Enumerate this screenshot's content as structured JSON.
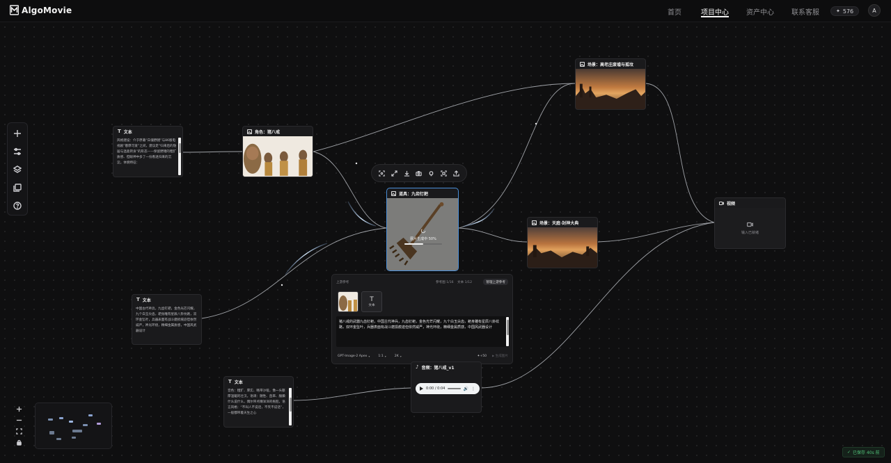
{
  "app": {
    "name": "AlgoMovie"
  },
  "nav": {
    "items": [
      {
        "label": "首页",
        "active": false
      },
      {
        "label": "项目中心",
        "active": true
      },
      {
        "label": "资产中心",
        "active": false
      },
      {
        "label": "联系客服",
        "active": false
      }
    ]
  },
  "credits": {
    "value": "576"
  },
  "user": {
    "initial": "A"
  },
  "toolbar": {
    "tools": [
      "plus-icon",
      "sliders-icon",
      "layers-icon",
      "gallery-icon",
      "help-icon"
    ]
  },
  "nodes": {
    "text1": {
      "title": "文本",
      "content": "风格建设：介于原著“白僵野猪”与86版电视剧“憨厚可爱”之间，建议走“归来后的隐居与温柔转身”的形态——保留野猪的粗犷质感、但眼神中多了一份看透归来的沉淀。体貌特征："
    },
    "character": {
      "title": "角色：猪八戒"
    },
    "prop": {
      "title": "道具：九齿钉耙",
      "progress_label": "图片生成中 50%",
      "progress": 0.5
    },
    "scene1": {
      "title": "场景：高老庄废墟与孤坟"
    },
    "scene2": {
      "title": "场景：天庭·封神大典"
    },
    "video": {
      "title": "视频",
      "placeholder": "输入已就绪"
    },
    "text2": {
      "title": "文本",
      "content": "中国古代神兵，九齿钉耙，金色光芒闪耀，九个白玉尖齿，耙身雕有星辰八卦纹路，双环金坠叶，兵器表面有战斗磨损痕迹但依然威严，神光环绕，精细金属质感，中国风武器设计"
    },
    "text3": {
      "title": "文本",
      "content": "音色：粗犷、厚实、略带沙哑，像一头憨厚温暖的壮汉。语调：随性、直率、腼腆什么说什么，偶尔带点懒洋洋的拖腔。语言风格：“不叫人不说话，不笑不说话”，一般都带着天生之心"
    },
    "audio": {
      "title": "音频：猪八戒_v1",
      "time": "0:00 / 0:04"
    }
  },
  "panel": {
    "label": "上游参考",
    "ref_count": "参考图 1/16",
    "text_count": "文本 1/12",
    "manage_button": "管理上游参考",
    "thumb_text_label": "文本",
    "prompt": "猪八戒的武器九齿钉耙，中国古代神兵，九齿钉耙，金色光芒闪耀，九个白玉尖齿，耙身雕有星辰八卦纹路，双环金坠叶，兵器表面有战斗磨损痕迹但依然威严，神光环绕，精细金属质感，中国风武器设计",
    "model": "GPT-Image-2 Apex",
    "ratio": "1:1",
    "resolution": "2K",
    "cost": "+50",
    "generate": "生成图片"
  },
  "status": {
    "saved": "已保存 40s 前"
  },
  "colors": {
    "accent_selected": "#4a8fd9",
    "saved_green": "#52c27a",
    "background": "#0f0f10"
  }
}
